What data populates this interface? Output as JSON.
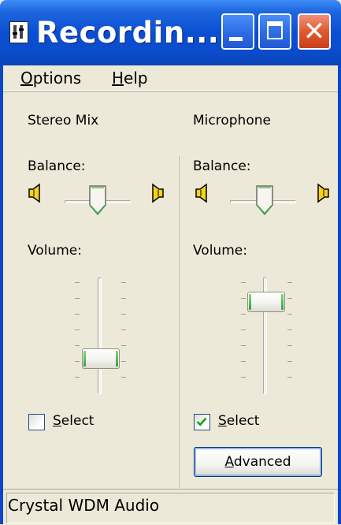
{
  "window": {
    "title": "Recordin...",
    "buttons": {
      "minimize": "minimize-icon",
      "maximize": "maximize-icon",
      "close": "close-icon"
    }
  },
  "menu": {
    "options": {
      "accel": "O",
      "rest": "ptions"
    },
    "help": {
      "accel": "H",
      "rest": "elp"
    }
  },
  "channels": [
    {
      "name": "Stereo Mix",
      "balance_label": "Balance:",
      "balance_value": 0.5,
      "volume_label": "Volume:",
      "volume_level": 0.29,
      "select": {
        "accel": "S",
        "rest": "elect",
        "checked": false
      }
    },
    {
      "name": "Microphone",
      "balance_label": "Balance:",
      "balance_value": 0.5,
      "volume_label": "Volume:",
      "volume_level": 0.81,
      "select": {
        "accel": "S",
        "rest": "elect",
        "checked": true
      },
      "advanced_button": {
        "accel": "A",
        "rest": "dvanced"
      }
    }
  ],
  "statusbar": {
    "text": "Crystal WDM Audio"
  },
  "colors": {
    "title_blue": "#0A4FD3",
    "face": "#ECE9D8",
    "accent_green": "#32A13B",
    "close_red": "#E2582C"
  }
}
